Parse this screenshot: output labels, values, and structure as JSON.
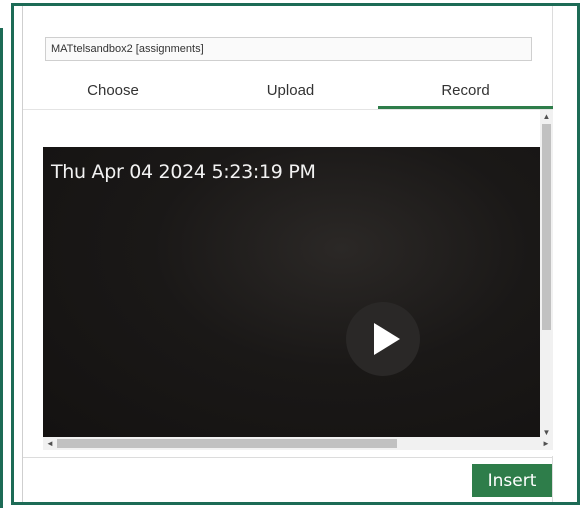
{
  "context_field": {
    "value": "MATtelsandbox2 [assignments]"
  },
  "tabs": [
    {
      "label": "Choose",
      "active": false
    },
    {
      "label": "Upload",
      "active": false
    },
    {
      "label": "Record",
      "active": true
    }
  ],
  "video": {
    "timestamp": "Thu Apr 04 2024 5:23:19 PM",
    "play_icon": "play-icon"
  },
  "scrollbars": {
    "up_arrow": "▲",
    "down_arrow": "▼",
    "left_arrow": "◄",
    "right_arrow": "►"
  },
  "footer": {
    "insert_label": "Insert"
  },
  "colors": {
    "frame": "#1d6b56",
    "accent": "#2e7d4a",
    "video_bg": "#171514"
  }
}
